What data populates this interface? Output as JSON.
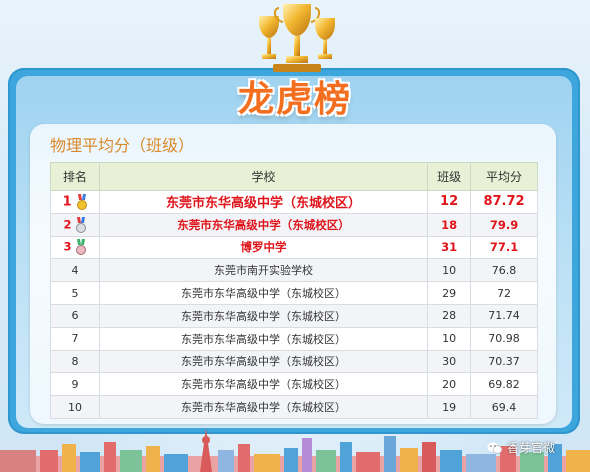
{
  "banner": {
    "title": "龙虎榜"
  },
  "section": {
    "title": "物理平均分（班级）"
  },
  "table": {
    "headers": [
      "排名",
      "学校",
      "班级",
      "平均分"
    ],
    "rows": [
      {
        "rank": "1",
        "school": "东莞市东华高级中学（东城校区）",
        "class": "12",
        "avg": "87.72",
        "medal": "gold"
      },
      {
        "rank": "2",
        "school": "东莞市东华高级中学（东城校区）",
        "class": "18",
        "avg": "79.9",
        "medal": "silver"
      },
      {
        "rank": "3",
        "school": "博罗中学",
        "class": "31",
        "avg": "77.1",
        "medal": "bronze"
      },
      {
        "rank": "4",
        "school": "东莞市南开实验学校",
        "class": "10",
        "avg": "76.8"
      },
      {
        "rank": "5",
        "school": "东莞市东华高级中学（东城校区）",
        "class": "29",
        "avg": "72"
      },
      {
        "rank": "6",
        "school": "东莞市东华高级中学（东城校区）",
        "class": "28",
        "avg": "71.74"
      },
      {
        "rank": "7",
        "school": "东莞市东华高级中学（东城校区）",
        "class": "10",
        "avg": "70.98"
      },
      {
        "rank": "8",
        "school": "东莞市东华高级中学（东城校区）",
        "class": "30",
        "avg": "70.37"
      },
      {
        "rank": "9",
        "school": "东莞市东华高级中学（东城校区）",
        "class": "20",
        "avg": "69.82"
      },
      {
        "rank": "10",
        "school": "东莞市东华高级中学（东城校区）",
        "class": "19",
        "avg": "69.4"
      }
    ]
  },
  "watermark": {
    "text": "香芽官微",
    "icon": "wechat-icon"
  },
  "colors": {
    "accent": "#f36f1f",
    "top_rank": "#e0141b",
    "header_bg": "#e8f0d6",
    "frame": "#3ca6dd"
  }
}
